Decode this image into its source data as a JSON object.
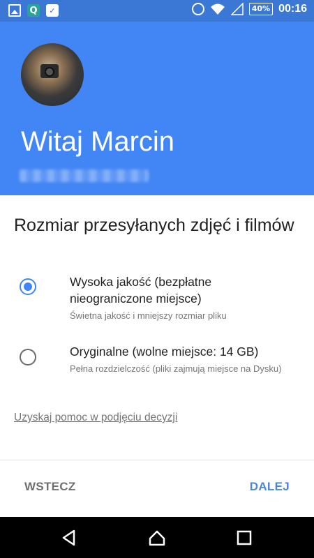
{
  "status_bar": {
    "battery": "40%",
    "time": "00:16",
    "icons": [
      "gallery-icon",
      "q-app-icon",
      "briefcase-check-icon",
      "alarm-icon",
      "wifi-icon",
      "signal-icon",
      "battery-icon"
    ]
  },
  "header": {
    "greeting": "Witaj Marcin"
  },
  "main": {
    "title": "Rozmiar przesyłanych zdjęć i filmów",
    "options": [
      {
        "title": "Wysoka jakość (bezpłatne nieograniczone miejsce)",
        "description": "Świetna jakość i mniejszy rozmiar pliku",
        "selected": true
      },
      {
        "title": "Oryginalne (wolne miejsce: 14 GB)",
        "description": "Pełna rozdzielczość (pliki zajmują miejsce na Dysku)",
        "selected": false
      }
    ],
    "help_link": "Uzyskaj pomoc w podjęciu decyzji"
  },
  "footer": {
    "back_label": "WSTECZ",
    "next_label": "DALEJ"
  },
  "colors": {
    "status_bar": "#3b78d6",
    "header": "#4285f4",
    "accent": "#4285f4",
    "next_button": "#4a86d8"
  }
}
